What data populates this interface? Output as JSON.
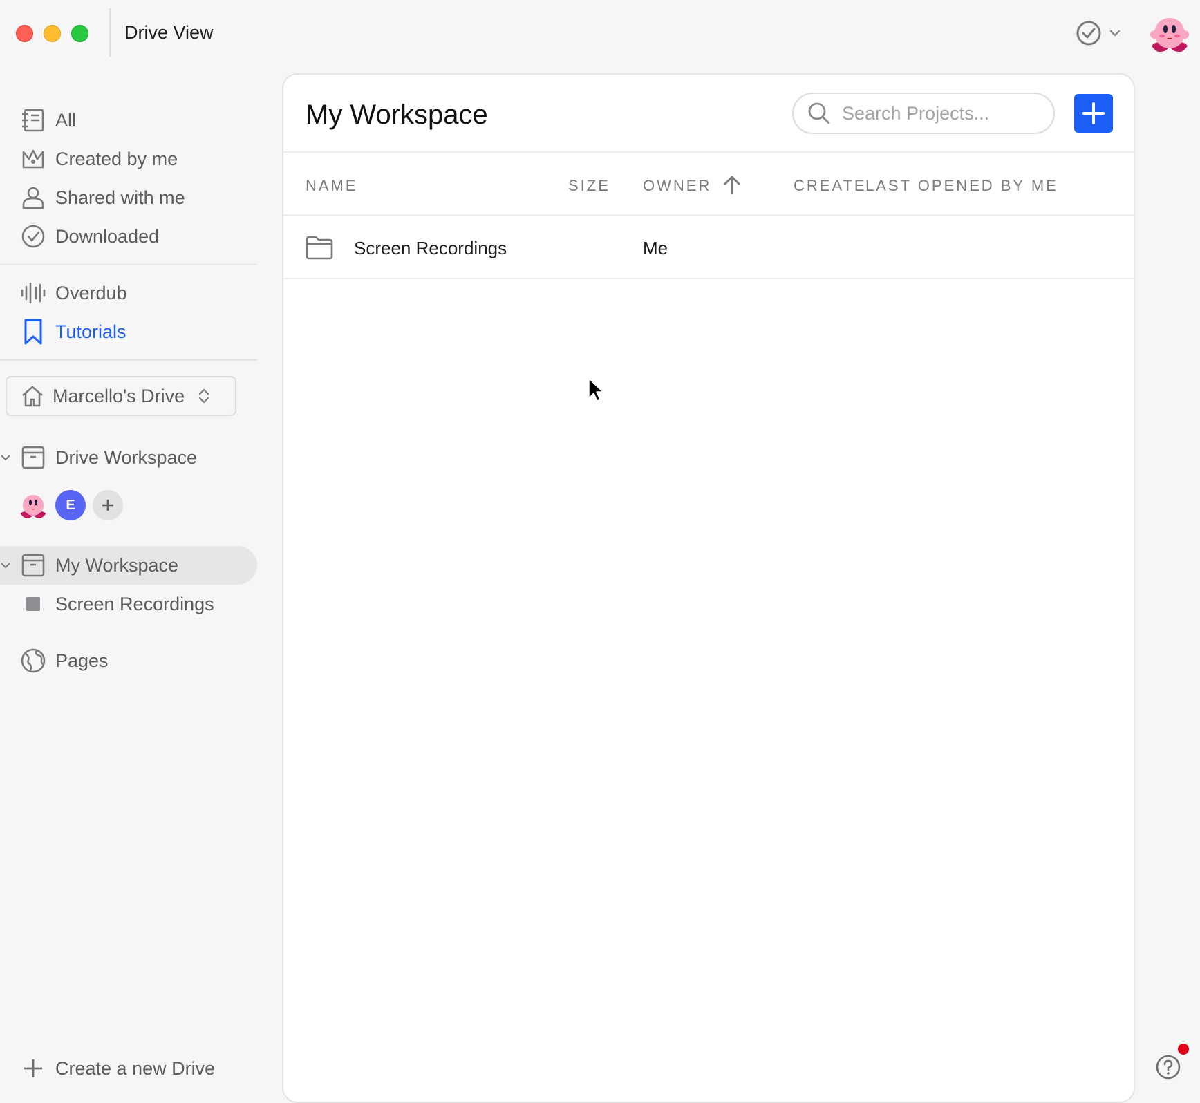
{
  "window": {
    "title": "Drive View"
  },
  "sidebar": {
    "primary": [
      {
        "label": "All",
        "icon": "notebook-icon"
      },
      {
        "label": "Created by me",
        "icon": "crown-icon"
      },
      {
        "label": "Shared with me",
        "icon": "person-icon"
      },
      {
        "label": "Downloaded",
        "icon": "check-circle-icon"
      }
    ],
    "secondary": [
      {
        "label": "Overdub",
        "icon": "waveform-icon"
      },
      {
        "label": "Tutorials",
        "icon": "bookmark-icon",
        "active": true
      }
    ],
    "drive_selector": {
      "label": "Marcello's Drive"
    },
    "drive_workspace": {
      "label": "Drive Workspace",
      "member_initial": "E"
    },
    "my_workspace": {
      "label": "My Workspace",
      "child": "Screen Recordings"
    },
    "pages": {
      "label": "Pages"
    },
    "create_drive": {
      "label": "Create a new Drive"
    }
  },
  "main": {
    "title": "My Workspace",
    "search": {
      "placeholder": "Search Projects..."
    },
    "columns": {
      "name": "NAME",
      "size": "SIZE",
      "owner": "OWNER",
      "created": "CREATE",
      "last_opened": "LAST OPENED BY ME"
    },
    "rows": [
      {
        "name": "Screen Recordings",
        "size": "",
        "owner": "Me"
      }
    ]
  },
  "colors": {
    "accent": "#1a5ef5",
    "sidebar_bg": "#f6f6f6",
    "selected_row": "#e6e6e6"
  }
}
